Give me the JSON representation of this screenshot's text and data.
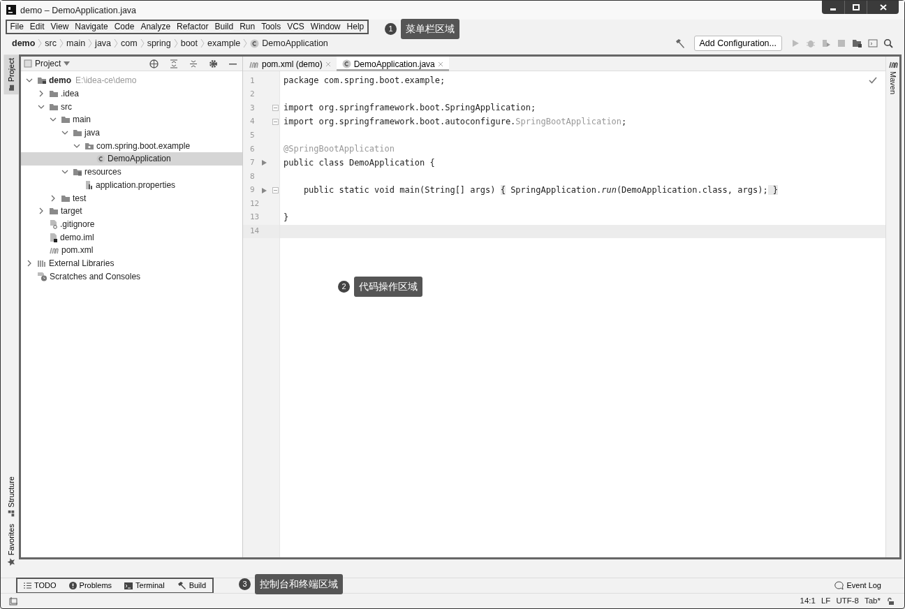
{
  "window": {
    "title": "demo – DemoApplication.java"
  },
  "menu": [
    {
      "label": "File"
    },
    {
      "label": "Edit"
    },
    {
      "label": "View"
    },
    {
      "label": "Navigate"
    },
    {
      "label": "Code"
    },
    {
      "label": "Analyze"
    },
    {
      "label": "Refactor"
    },
    {
      "label": "Build"
    },
    {
      "label": "Run"
    },
    {
      "label": "Tools"
    },
    {
      "label": "VCS"
    },
    {
      "label": "Window"
    },
    {
      "label": "Help"
    }
  ],
  "breadcrumbs": [
    {
      "label": "demo",
      "kind": "module"
    },
    {
      "label": "src",
      "kind": "folder"
    },
    {
      "label": "main",
      "kind": "folder"
    },
    {
      "label": "java",
      "kind": "folder"
    },
    {
      "label": "com",
      "kind": "folder"
    },
    {
      "label": "spring",
      "kind": "folder"
    },
    {
      "label": "boot",
      "kind": "folder"
    },
    {
      "label": "example",
      "kind": "folder"
    },
    {
      "label": "DemoApplication",
      "kind": "class"
    }
  ],
  "toolbar": {
    "configuration_button": "Add Configuration..."
  },
  "left_stripe": {
    "top": [
      {
        "label": "Project",
        "selected": true
      }
    ],
    "bottom": [
      {
        "label": "Structure",
        "selected": false
      },
      {
        "label": "Favorites",
        "selected": false
      }
    ]
  },
  "right_stripe": [
    {
      "label": "Maven"
    }
  ],
  "project_panel": {
    "title": "Project",
    "tree": [
      {
        "label": "demo",
        "hint": "E:\\idea-ce\\demo",
        "kind": "module",
        "expanded": true,
        "selected": false,
        "children": [
          {
            "label": ".idea",
            "kind": "folder",
            "expanded": false,
            "selected": false
          },
          {
            "label": "src",
            "kind": "folder",
            "expanded": true,
            "selected": false,
            "children": [
              {
                "label": "main",
                "kind": "folder",
                "expanded": true,
                "selected": false,
                "children": [
                  {
                    "label": "java",
                    "kind": "folder",
                    "expanded": true,
                    "selected": false,
                    "children": [
                      {
                        "label": "com.spring.boot.example",
                        "kind": "package",
                        "expanded": true,
                        "selected": false,
                        "children": [
                          {
                            "label": "DemoApplication",
                            "kind": "class",
                            "selected": true
                          }
                        ]
                      }
                    ]
                  },
                  {
                    "label": "resources",
                    "kind": "resources",
                    "expanded": true,
                    "selected": false,
                    "children": [
                      {
                        "label": "application.properties",
                        "kind": "properties",
                        "selected": false
                      }
                    ]
                  }
                ]
              },
              {
                "label": "test",
                "kind": "folder",
                "expanded": false,
                "selected": false
              }
            ]
          },
          {
            "label": "target",
            "kind": "folder",
            "expanded": false,
            "selected": false
          },
          {
            "label": ".gitignore",
            "kind": "ignore",
            "selected": false
          },
          {
            "label": "demo.iml",
            "kind": "iml",
            "selected": false
          },
          {
            "label": "pom.xml",
            "kind": "maven",
            "selected": false
          }
        ]
      },
      {
        "label": "External Libraries",
        "kind": "libraries",
        "expanded": false,
        "selected": false
      },
      {
        "label": "Scratches and Consoles",
        "kind": "scratches",
        "selected": false
      }
    ]
  },
  "editor": {
    "tabs": [
      {
        "label": "pom.xml (demo)",
        "kind": "maven",
        "selected": false
      },
      {
        "label": "DemoApplication.java",
        "kind": "class",
        "selected": true
      }
    ],
    "lines": [
      {
        "number": "1",
        "segments": [
          {
            "text": "package com.spring.boot.example;",
            "kind": "plain"
          }
        ]
      },
      {
        "number": "2"
      },
      {
        "number": "3",
        "fold_marker": true,
        "segments": [
          {
            "text": "import org.springframework.boot.SpringApplication;",
            "kind": "plain"
          }
        ]
      },
      {
        "number": "4",
        "fold_marker": true,
        "segments": [
          {
            "text": "import org.springframework.boot.autoconfigure.",
            "kind": "plain"
          },
          {
            "text": "SpringBootApplication",
            "kind": "muted"
          },
          {
            "text": ";",
            "kind": "plain"
          }
        ]
      },
      {
        "number": "5"
      },
      {
        "number": "6",
        "segments": [
          {
            "text": "@SpringBootApplication",
            "kind": "muted"
          }
        ]
      },
      {
        "number": "7",
        "run_marker": true,
        "segments": [
          {
            "text": "public class DemoApplication {",
            "kind": "plain"
          }
        ]
      },
      {
        "number": "8"
      },
      {
        "number": "9",
        "run_marker": true,
        "fold_marker": true,
        "segments": [
          {
            "text": "    public static void main(String[] args) ",
            "kind": "plain"
          },
          {
            "text": "{",
            "kind": "folded"
          },
          {
            "text": " SpringApplication.",
            "kind": "plain"
          },
          {
            "text": "run",
            "kind": "italic"
          },
          {
            "text": "(DemoApplication.class, args);",
            "kind": "plain"
          },
          {
            "text": " }",
            "kind": "folded"
          }
        ]
      },
      {
        "number": "12"
      },
      {
        "number": "13",
        "segments": [
          {
            "text": "}",
            "kind": "plain"
          }
        ]
      },
      {
        "number": "14",
        "current": true
      }
    ]
  },
  "tool_windows": [
    {
      "label": "TODO",
      "kind": "todo"
    },
    {
      "label": "Problems",
      "kind": "problems"
    },
    {
      "label": "Terminal",
      "kind": "terminal"
    },
    {
      "label": "Build",
      "kind": "build"
    }
  ],
  "event_log": "Event Log",
  "status_bar": [
    "14:1",
    "LF",
    "UTF-8",
    "Tab*"
  ],
  "annotations": [
    {
      "number": "1",
      "label": "菜单栏区域"
    },
    {
      "number": "2",
      "label": "代码操作区域"
    },
    {
      "number": "3",
      "label": "控制台和终端区域"
    }
  ]
}
